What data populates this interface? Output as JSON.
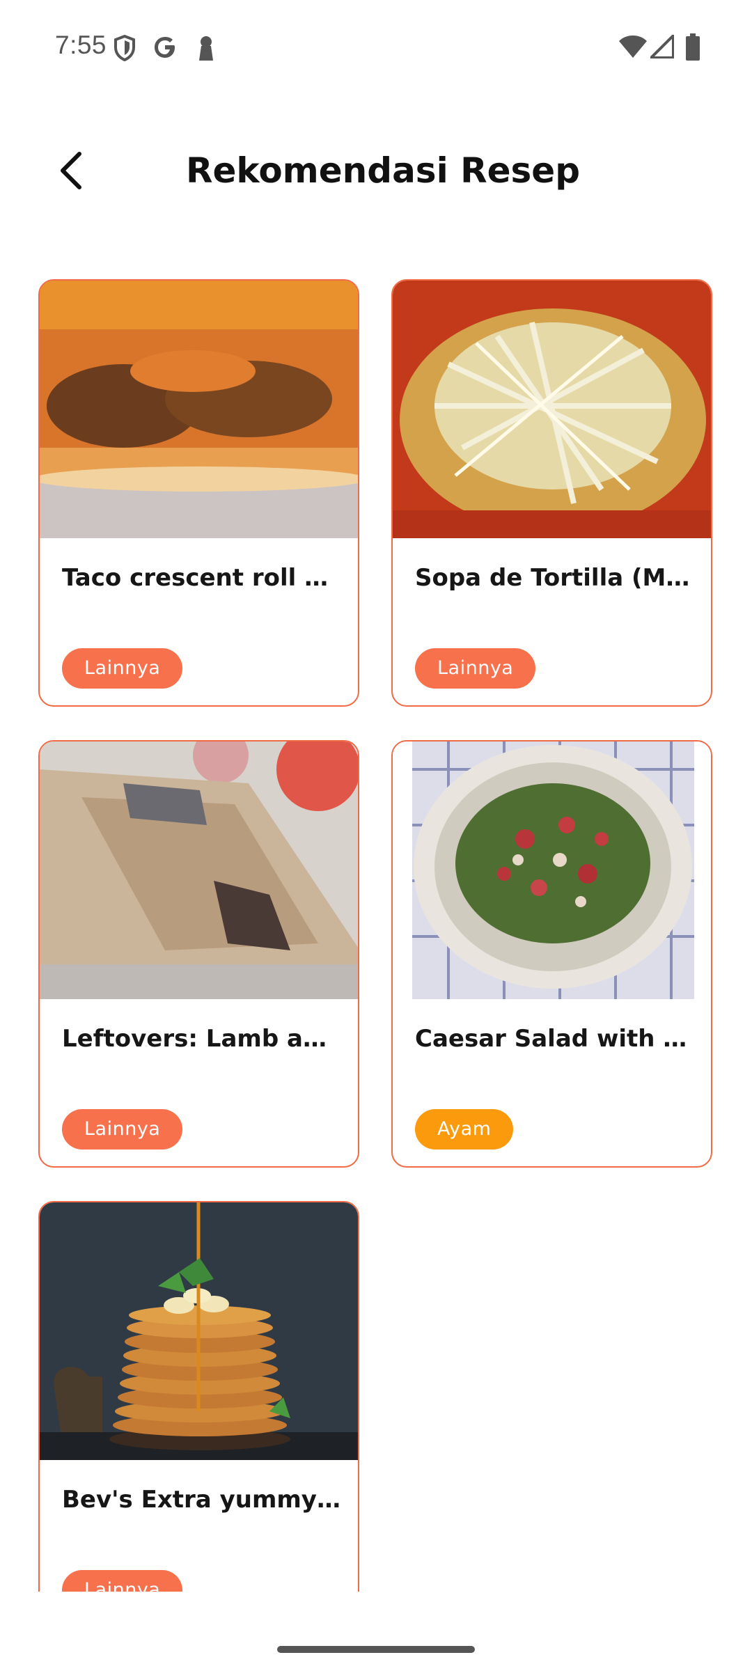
{
  "status_bar": {
    "time": "7:55"
  },
  "header": {
    "title": "Rekomendasi Resep",
    "back_icon": "chevron-left-icon"
  },
  "colors": {
    "accent": "#f26a45",
    "badge_lainnya": "#f7714d",
    "badge_ayam": "#fa9a0c"
  },
  "recipes": [
    {
      "title": "Taco crescent roll …",
      "category": "Lainnya"
    },
    {
      "title": "Sopa de Tortilla (M…",
      "category": "Lainnya"
    },
    {
      "title": "Leftovers: Lamb an…",
      "category": "Lainnya"
    },
    {
      "title": "Caesar Salad with …",
      "category": "Ayam"
    },
    {
      "title": "Bev's Extra yummy…",
      "category": "Lainnya"
    }
  ]
}
